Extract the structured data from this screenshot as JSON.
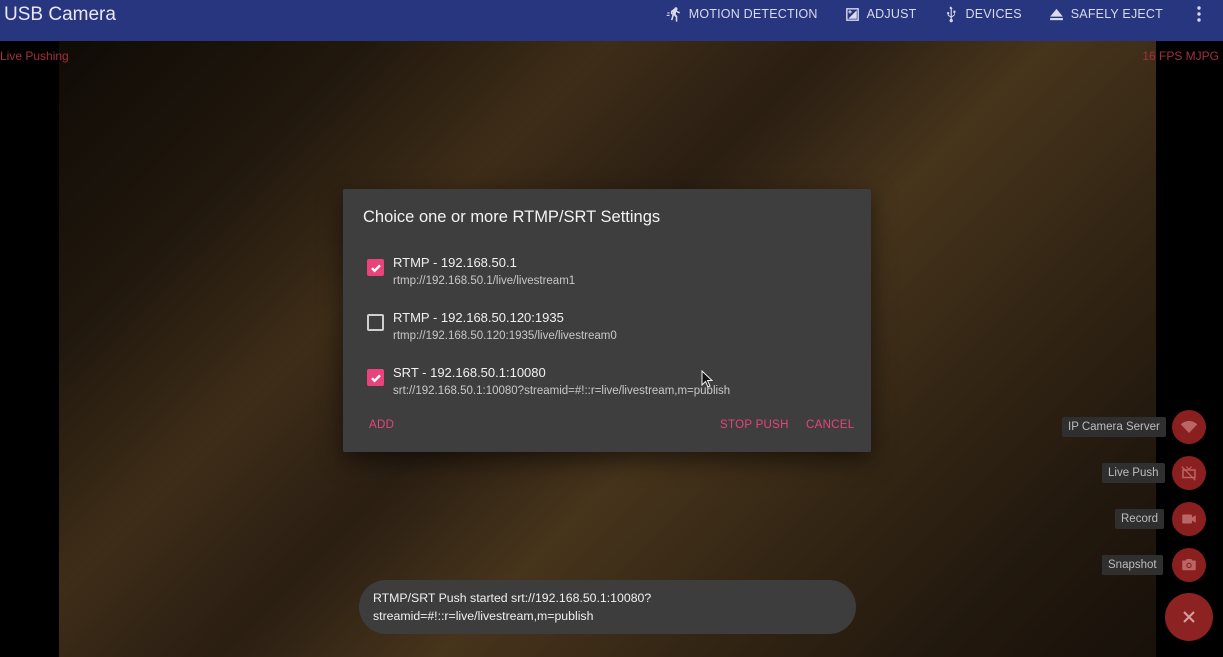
{
  "appbar": {
    "title": "USB Camera",
    "actions": [
      {
        "label": "MOTION DETECTION",
        "icon": "motion-icon"
      },
      {
        "label": "ADJUST",
        "icon": "adjust-icon"
      },
      {
        "label": "DEVICES",
        "icon": "usb-icon"
      },
      {
        "label": "SAFELY EJECT",
        "icon": "eject-icon"
      }
    ],
    "overflow_icon": "more-vert-icon"
  },
  "preview": {
    "status_left": "Live Pushing",
    "status_right": "16 FPS MJPG"
  },
  "dialog": {
    "title": "Choice one or more RTMP/SRT Settings",
    "options": [
      {
        "title": "RTMP - 192.168.50.1",
        "url": "rtmp://192.168.50.1/live/livestream1",
        "checked": true
      },
      {
        "title": "RTMP - 192.168.50.120:1935",
        "url": "rtmp://192.168.50.120:1935/live/livestream0",
        "checked": false
      },
      {
        "title": "SRT - 192.168.50.1:10080",
        "url": "srt://192.168.50.1:10080?streamid=#!::r=live/livestream,m=publish",
        "checked": true
      }
    ],
    "add_label": "ADD",
    "stop_label": "STOP PUSH",
    "cancel_label": "CANCEL"
  },
  "fab_menu": {
    "items": [
      {
        "label": "IP Camera Server",
        "icon": "wifi-icon"
      },
      {
        "label": "Live Push",
        "icon": "live-tv-off-icon"
      },
      {
        "label": "Record",
        "icon": "videocam-icon"
      },
      {
        "label": "Snapshot",
        "icon": "camera-icon"
      }
    ],
    "close_icon": "close-icon"
  },
  "toast": {
    "message": "RTMP/SRT Push started srt://192.168.50.1:10080?streamid=#!::r=live/livestream,m=publish"
  },
  "colors": {
    "appbar": "#28357f",
    "accent": "#e8437a",
    "dialog": "#3e3e3e",
    "status": "#a3303c",
    "fab": "#8a1f1f"
  }
}
